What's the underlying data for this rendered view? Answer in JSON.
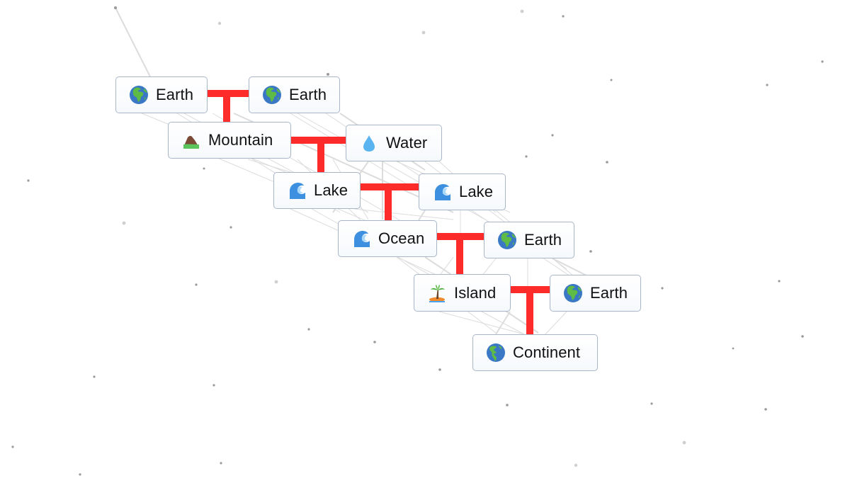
{
  "app": "Infinite Craft recipe tree",
  "connector_color": "#fe2b2b",
  "nodes": [
    {
      "id": "earth-a",
      "label": "Earth",
      "icon": "globe-africa-icon"
    },
    {
      "id": "earth-b",
      "label": "Earth",
      "icon": "globe-africa-icon"
    },
    {
      "id": "mountain",
      "label": "Mountain",
      "icon": "mountain-icon"
    },
    {
      "id": "water",
      "label": "Water",
      "icon": "water-drop-icon"
    },
    {
      "id": "lake-a",
      "label": "Lake",
      "icon": "wave-icon"
    },
    {
      "id": "lake-b",
      "label": "Lake",
      "icon": "wave-icon"
    },
    {
      "id": "ocean",
      "label": "Ocean",
      "icon": "wave-icon"
    },
    {
      "id": "earth-c",
      "label": "Earth",
      "icon": "globe-africa-icon"
    },
    {
      "id": "island",
      "label": "Island",
      "icon": "island-icon"
    },
    {
      "id": "earth-d",
      "label": "Earth",
      "icon": "globe-africa-icon"
    },
    {
      "id": "continent",
      "label": "Continent",
      "icon": "globe-americas-icon"
    }
  ],
  "recipes": [
    {
      "inputs": [
        "Earth",
        "Earth"
      ],
      "result": "Mountain"
    },
    {
      "inputs": [
        "Mountain",
        "Water"
      ],
      "result": "Lake"
    },
    {
      "inputs": [
        "Lake",
        "Lake"
      ],
      "result": "Ocean"
    },
    {
      "inputs": [
        "Ocean",
        "Earth"
      ],
      "result": "Island"
    },
    {
      "inputs": [
        "Island",
        "Earth"
      ],
      "result": "Continent"
    }
  ]
}
